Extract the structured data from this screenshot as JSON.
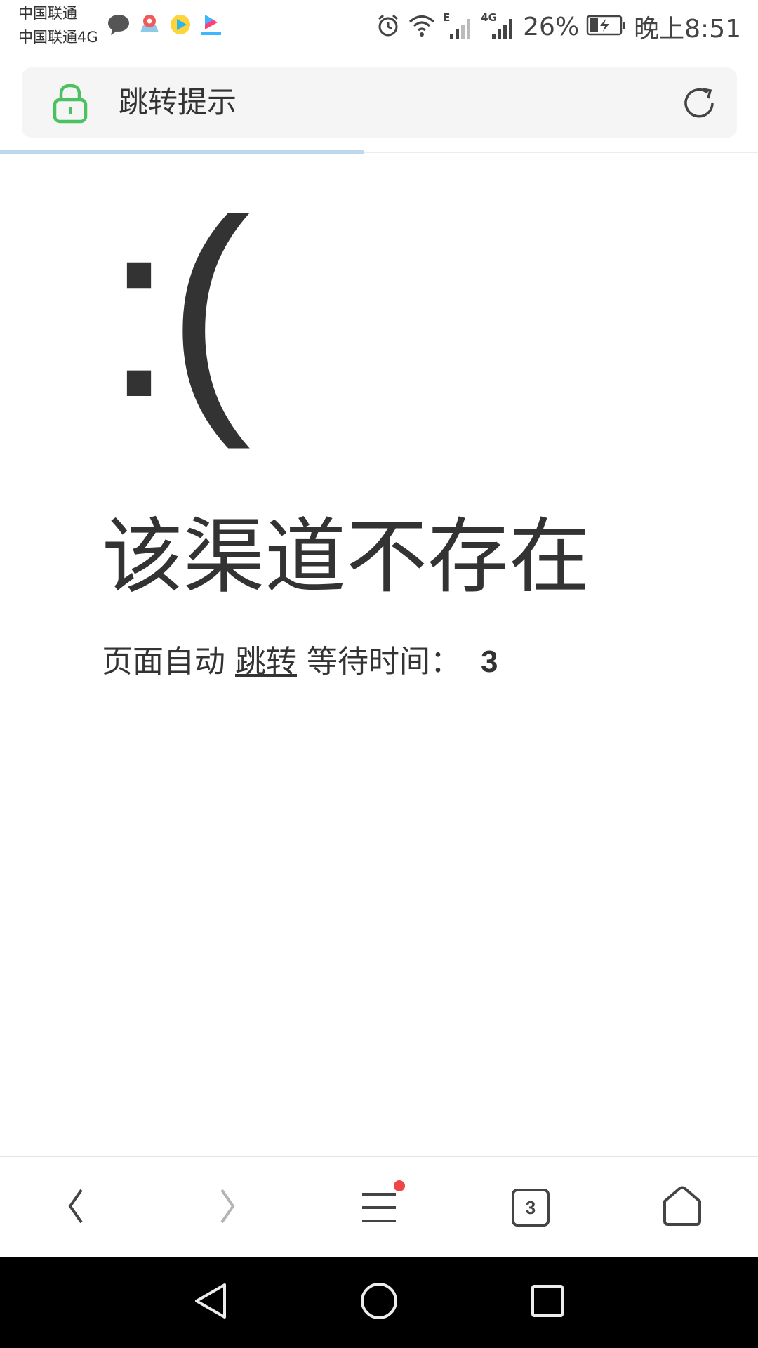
{
  "status_bar": {
    "carrier_1": "中国联通",
    "carrier_2": "中国联通4G",
    "network_e": "E",
    "network_4g": "4G",
    "battery": "26%",
    "time": "晚上8:51"
  },
  "address_bar": {
    "title": "跳转提示",
    "lock_icon": "lock-icon",
    "reload_icon": "reload-icon",
    "lock_color": "#4cc162",
    "load_progress": 0.48
  },
  "content": {
    "sad_face": ":(",
    "headline": "该渠道不存在",
    "redirect_prefix": "页面自动",
    "redirect_link": "跳转",
    "redirect_suffix": "等待时间：",
    "countdown": "3"
  },
  "toolbar": {
    "back_icon": "back-arrow-icon",
    "forward_icon": "forward-arrow-icon",
    "menu_icon": "menu-icon",
    "tab_count": "3",
    "home_icon": "home-icon",
    "notification_dot_color": "#f04545"
  },
  "system_nav": {
    "back": "nav-back-icon",
    "home": "nav-home-icon",
    "recents": "nav-recents-icon"
  }
}
